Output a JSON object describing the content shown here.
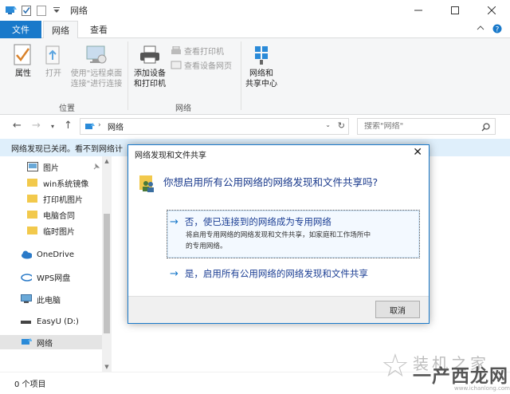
{
  "window": {
    "title": "网络"
  },
  "ribbon_tabs": {
    "file": "文件",
    "network": "网络",
    "view": "查看"
  },
  "ribbon": {
    "properties": "属性",
    "open": "打开",
    "remote_line1": "使用\"远程桌面",
    "remote_line2": "连接\"进行连接",
    "view_printers": "查看打印机",
    "view_device_pages": "查看设备网页",
    "add_devices_line1": "添加设备",
    "add_devices_line2": "和打印机",
    "network_center_line1": "网络和",
    "network_center_line2": "共享中心",
    "group_location": "位置",
    "group_network": "网络"
  },
  "address": {
    "path": "网络",
    "search_placeholder": "搜索\"网络\""
  },
  "infobar": {
    "text": "网络发现已关闭。看不到网络计"
  },
  "sidebar": {
    "items": [
      {
        "label": "图片"
      },
      {
        "label": "win系统镜像"
      },
      {
        "label": "打印机图片"
      },
      {
        "label": "电脑合同"
      },
      {
        "label": "临时图片"
      },
      {
        "label": "OneDrive"
      },
      {
        "label": "WPS网盘"
      },
      {
        "label": "此电脑"
      },
      {
        "label": "EasyU (D:)"
      },
      {
        "label": "网络"
      }
    ]
  },
  "status": {
    "count": "0 个项目"
  },
  "dialog": {
    "title": "网络发现和文件共享",
    "question": "你想启用所有公用网络的网络发现和文件共享吗?",
    "option1_title": "否，使已连接到的网络成为专用网络",
    "option1_desc_line1": "将启用专用网络的网络发现和文件共享，如家庭和工作场所中",
    "option1_desc_line2": "的专用网络。",
    "option2_title": "是，启用所有公用网络的网络发现和文件共享",
    "cancel": "取消"
  },
  "watermark": {
    "faint": "装机之家",
    "brand": "一产西龙网",
    "url": "www.ichanlong.com"
  },
  "colors": {
    "accent": "#1979ca",
    "infobar": "#dfeffb",
    "ribbon_bg": "#f5f6f7"
  }
}
